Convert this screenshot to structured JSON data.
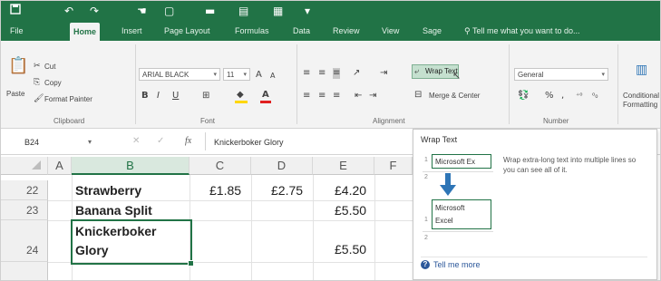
{
  "quick_access": {
    "save_icon": "save-icon",
    "undo_icon": "undo-icon",
    "redo_icon": "redo-icon"
  },
  "ribbon_tabs": [
    "File",
    "Home",
    "Insert",
    "Page Layout",
    "Formulas",
    "Data",
    "Review",
    "View",
    "Sage"
  ],
  "active_tab": "Home",
  "tell_me": "Tell me what you want to do...",
  "clipboard": {
    "paste": "Paste",
    "cut": "Cut",
    "copy": "Copy",
    "format_painter": "Format Painter",
    "group_label": "Clipboard"
  },
  "font": {
    "name": "ARIAL BLACK",
    "size": "11",
    "group_label": "Font",
    "bold": "B",
    "italic": "I",
    "underline": "U"
  },
  "alignment": {
    "wrap_text": "Wrap Text",
    "merge_center": "Merge & Center",
    "group_label": "Alignment"
  },
  "number": {
    "format": "General",
    "group_label": "Number",
    "percent": "%"
  },
  "styles": {
    "conditional_formatting": "Conditional Formatting"
  },
  "formula_bar": {
    "name_box": "B24",
    "fx": "fx",
    "formula": "Knickerboker Glory"
  },
  "columns": [
    "A",
    "B",
    "C",
    "D",
    "E",
    "F"
  ],
  "selected_column": "B",
  "rows": [
    {
      "row": "22",
      "b": "Strawberry",
      "c": "£1.85",
      "d": "£2.75",
      "e": "£4.20"
    },
    {
      "row": "23",
      "b": "Banana Split",
      "c": "",
      "d": "",
      "e": "£5.50"
    },
    {
      "row": "24",
      "b_line1": "Knickerboker",
      "b_line2": "Glory",
      "c": "",
      "d": "",
      "e": "£5.50"
    }
  ],
  "tooltip": {
    "title": "Wrap Text",
    "description": "Wrap extra-long text into multiple lines so you can see all of it.",
    "example_before": "Microsoft Ex",
    "example_after_line1": "Microsoft",
    "example_after_line2": "Excel",
    "row1": "1",
    "row2": "2",
    "tell_me_more": "Tell me more"
  },
  "colors": {
    "excel_green": "#217346",
    "ribbon_bg": "#f3f3f3",
    "selection_green": "#217346",
    "arrow_blue": "#2e75b6"
  }
}
